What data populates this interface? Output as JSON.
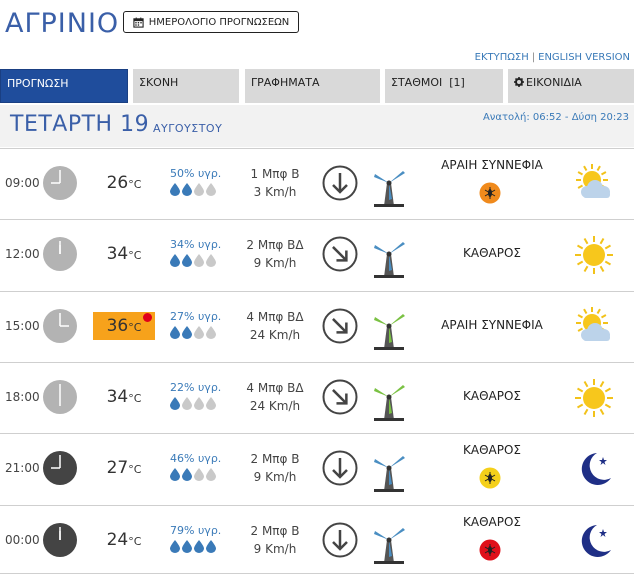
{
  "header": {
    "city": "ΑΓΡΙΝΙΟ",
    "calendar_button": "ΗΜΕΡΟΛΟΓΙΟ ΠΡΟΓΝΩΣΕΩΝ",
    "print_link": "ΕΚΤΥΠΩΣΗ",
    "separator": "|",
    "english_link": "ENGLISH VERSION"
  },
  "tabs": [
    {
      "label": "ΠΡΟΓΝΩΣΗ",
      "active": true
    },
    {
      "label": "ΣΚΟΝΗ",
      "active": false
    },
    {
      "label": "ΓΡΑΦΗΜΑΤΑ",
      "active": false
    },
    {
      "label": "ΣΤΑΘΜΟΙ  [1]",
      "active": false
    },
    {
      "label": "ΕΙΚΟΝΙΔΙΑ",
      "active": false,
      "icon": "gear-icon"
    }
  ],
  "day": {
    "name": "ΤΕΤΑΡΤΗ 19",
    "month": "ΑΥΓΟΥΣΤΟΥ",
    "sunrise_sunset": "Ανατολή: 06:52  - Δύση 20:23"
  },
  "colors": {
    "accent": "#1f4d9c",
    "hot": "#f7a21b",
    "alert": "#e0001a",
    "drop": "#3a7ab8"
  },
  "forecast": [
    {
      "time": "09:00",
      "clock": "day",
      "temp": "26",
      "unit": "°C",
      "hot": false,
      "humidity": "50% υγρ.",
      "drops": 2,
      "wind_beaufort": "1 Μπφ Β",
      "wind_speed": "3 Km/h",
      "arrow": "down",
      "mill": "blue",
      "condition": "ΑΡΑΙΗ ΣΥΝΝΕΦΙΑ",
      "bug": "orange",
      "weather": "sun-cloud"
    },
    {
      "time": "12:00",
      "clock": "day",
      "temp": "34",
      "unit": "°C",
      "hot": false,
      "humidity": "34% υγρ.",
      "drops": 2,
      "wind_beaufort": "2 Μπφ ΒΔ",
      "wind_speed": "9 Km/h",
      "arrow": "down-right",
      "mill": "blue",
      "condition": "ΚΑΘΑΡΟΣ",
      "bug": "",
      "weather": "sun"
    },
    {
      "time": "15:00",
      "clock": "day",
      "temp": "36",
      "unit": "°C",
      "hot": true,
      "humidity": "27% υγρ.",
      "drops": 2,
      "wind_beaufort": "4 Μπφ ΒΔ",
      "wind_speed": "24 Km/h",
      "arrow": "down-right",
      "mill": "green",
      "condition": "ΑΡΑΙΗ ΣΥΝΝΕΦΙΑ",
      "bug": "",
      "weather": "sun-cloud"
    },
    {
      "time": "18:00",
      "clock": "day",
      "temp": "34",
      "unit": "°C",
      "hot": false,
      "humidity": "22% υγρ.",
      "drops": 1,
      "wind_beaufort": "4 Μπφ ΒΔ",
      "wind_speed": "24 Km/h",
      "arrow": "down-right",
      "mill": "green",
      "condition": "ΚΑΘΑΡΟΣ",
      "bug": "",
      "weather": "sun"
    },
    {
      "time": "21:00",
      "clock": "night",
      "temp": "27",
      "unit": "°C",
      "hot": false,
      "humidity": "46% υγρ.",
      "drops": 2,
      "wind_beaufort": "2 Μπφ Β",
      "wind_speed": "9 Km/h",
      "arrow": "down",
      "mill": "blue",
      "condition": "ΚΑΘΑΡΟΣ",
      "bug": "yellow",
      "weather": "moon"
    },
    {
      "time": "00:00",
      "clock": "night",
      "temp": "24",
      "unit": "°C",
      "hot": false,
      "humidity": "79% υγρ.",
      "drops": 4,
      "wind_beaufort": "2 Μπφ Β",
      "wind_speed": "9 Km/h",
      "arrow": "down",
      "mill": "blue",
      "condition": "ΚΑΘΑΡΟΣ",
      "bug": "red",
      "weather": "moon"
    }
  ]
}
